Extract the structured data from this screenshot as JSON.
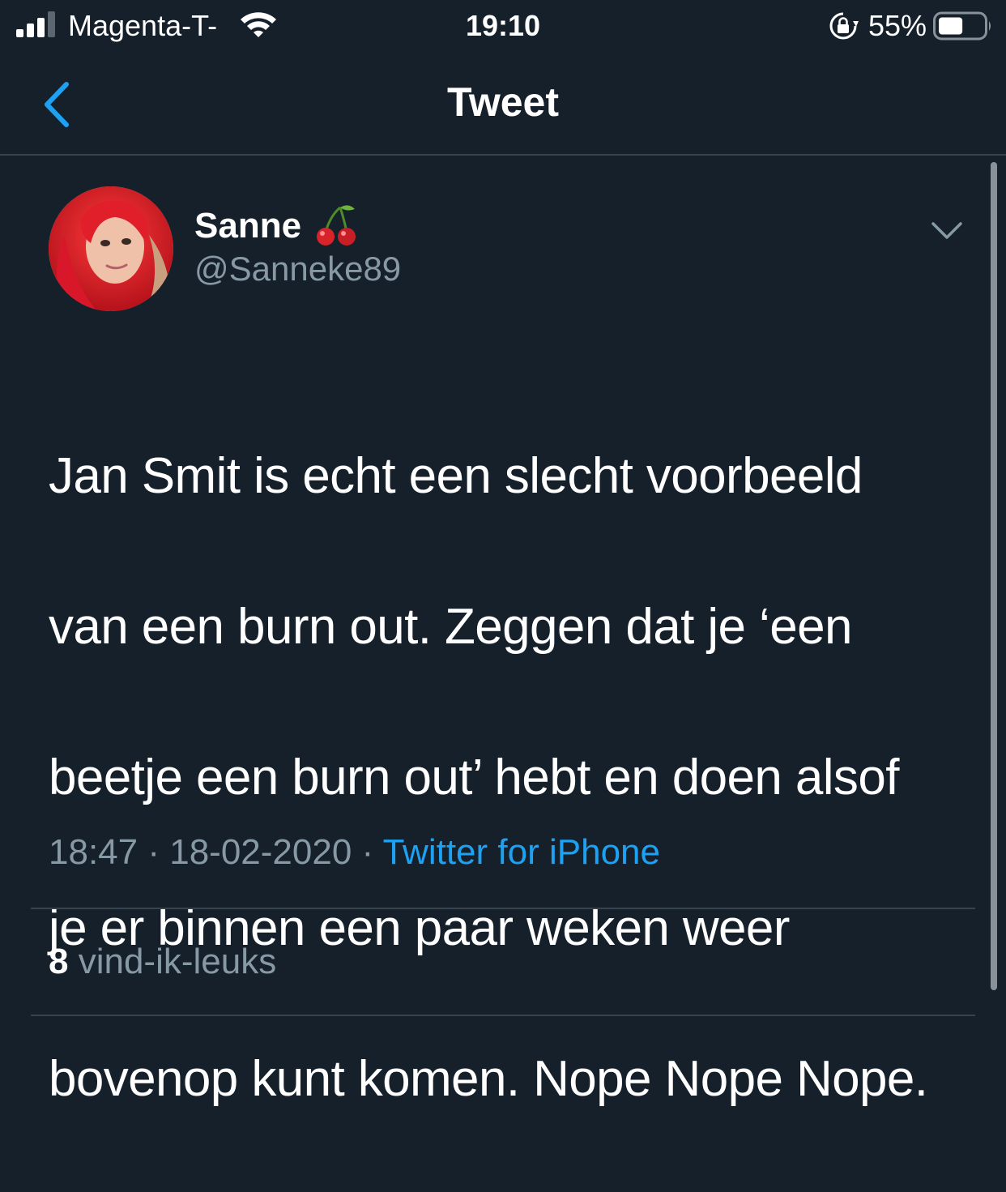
{
  "status_bar": {
    "carrier": "Magenta-T-",
    "time": "19:10",
    "battery_percent": "55%",
    "battery_level": 0.55,
    "signal_bars_filled": 3,
    "signal_bars_total": 4
  },
  "nav": {
    "title": "Tweet",
    "back_icon": "chevron-left-icon"
  },
  "tweet": {
    "display_name": "Sanne",
    "name_emoji": "cherry-icon",
    "handle": "@Sanneke89",
    "text_lines": [
      "Jan Smit is echt een slecht voorbeeld",
      "van een burn out. Zeggen dat je ‘een",
      "beetje een burn out’ hebt en doen alsof",
      "je er binnen een paar weken weer",
      "bovenop kunt komen. Nope Nope Nope."
    ],
    "time": "18:47",
    "separator": " · ",
    "date": "18-02-2020",
    "source": "Twitter for iPhone",
    "likes_count": "8",
    "likes_label": "vind-ik-leuks"
  },
  "colors": {
    "background": "#15202b",
    "accent": "#1da1f2",
    "secondary_text": "#8899a6",
    "divider": "#38444d"
  }
}
